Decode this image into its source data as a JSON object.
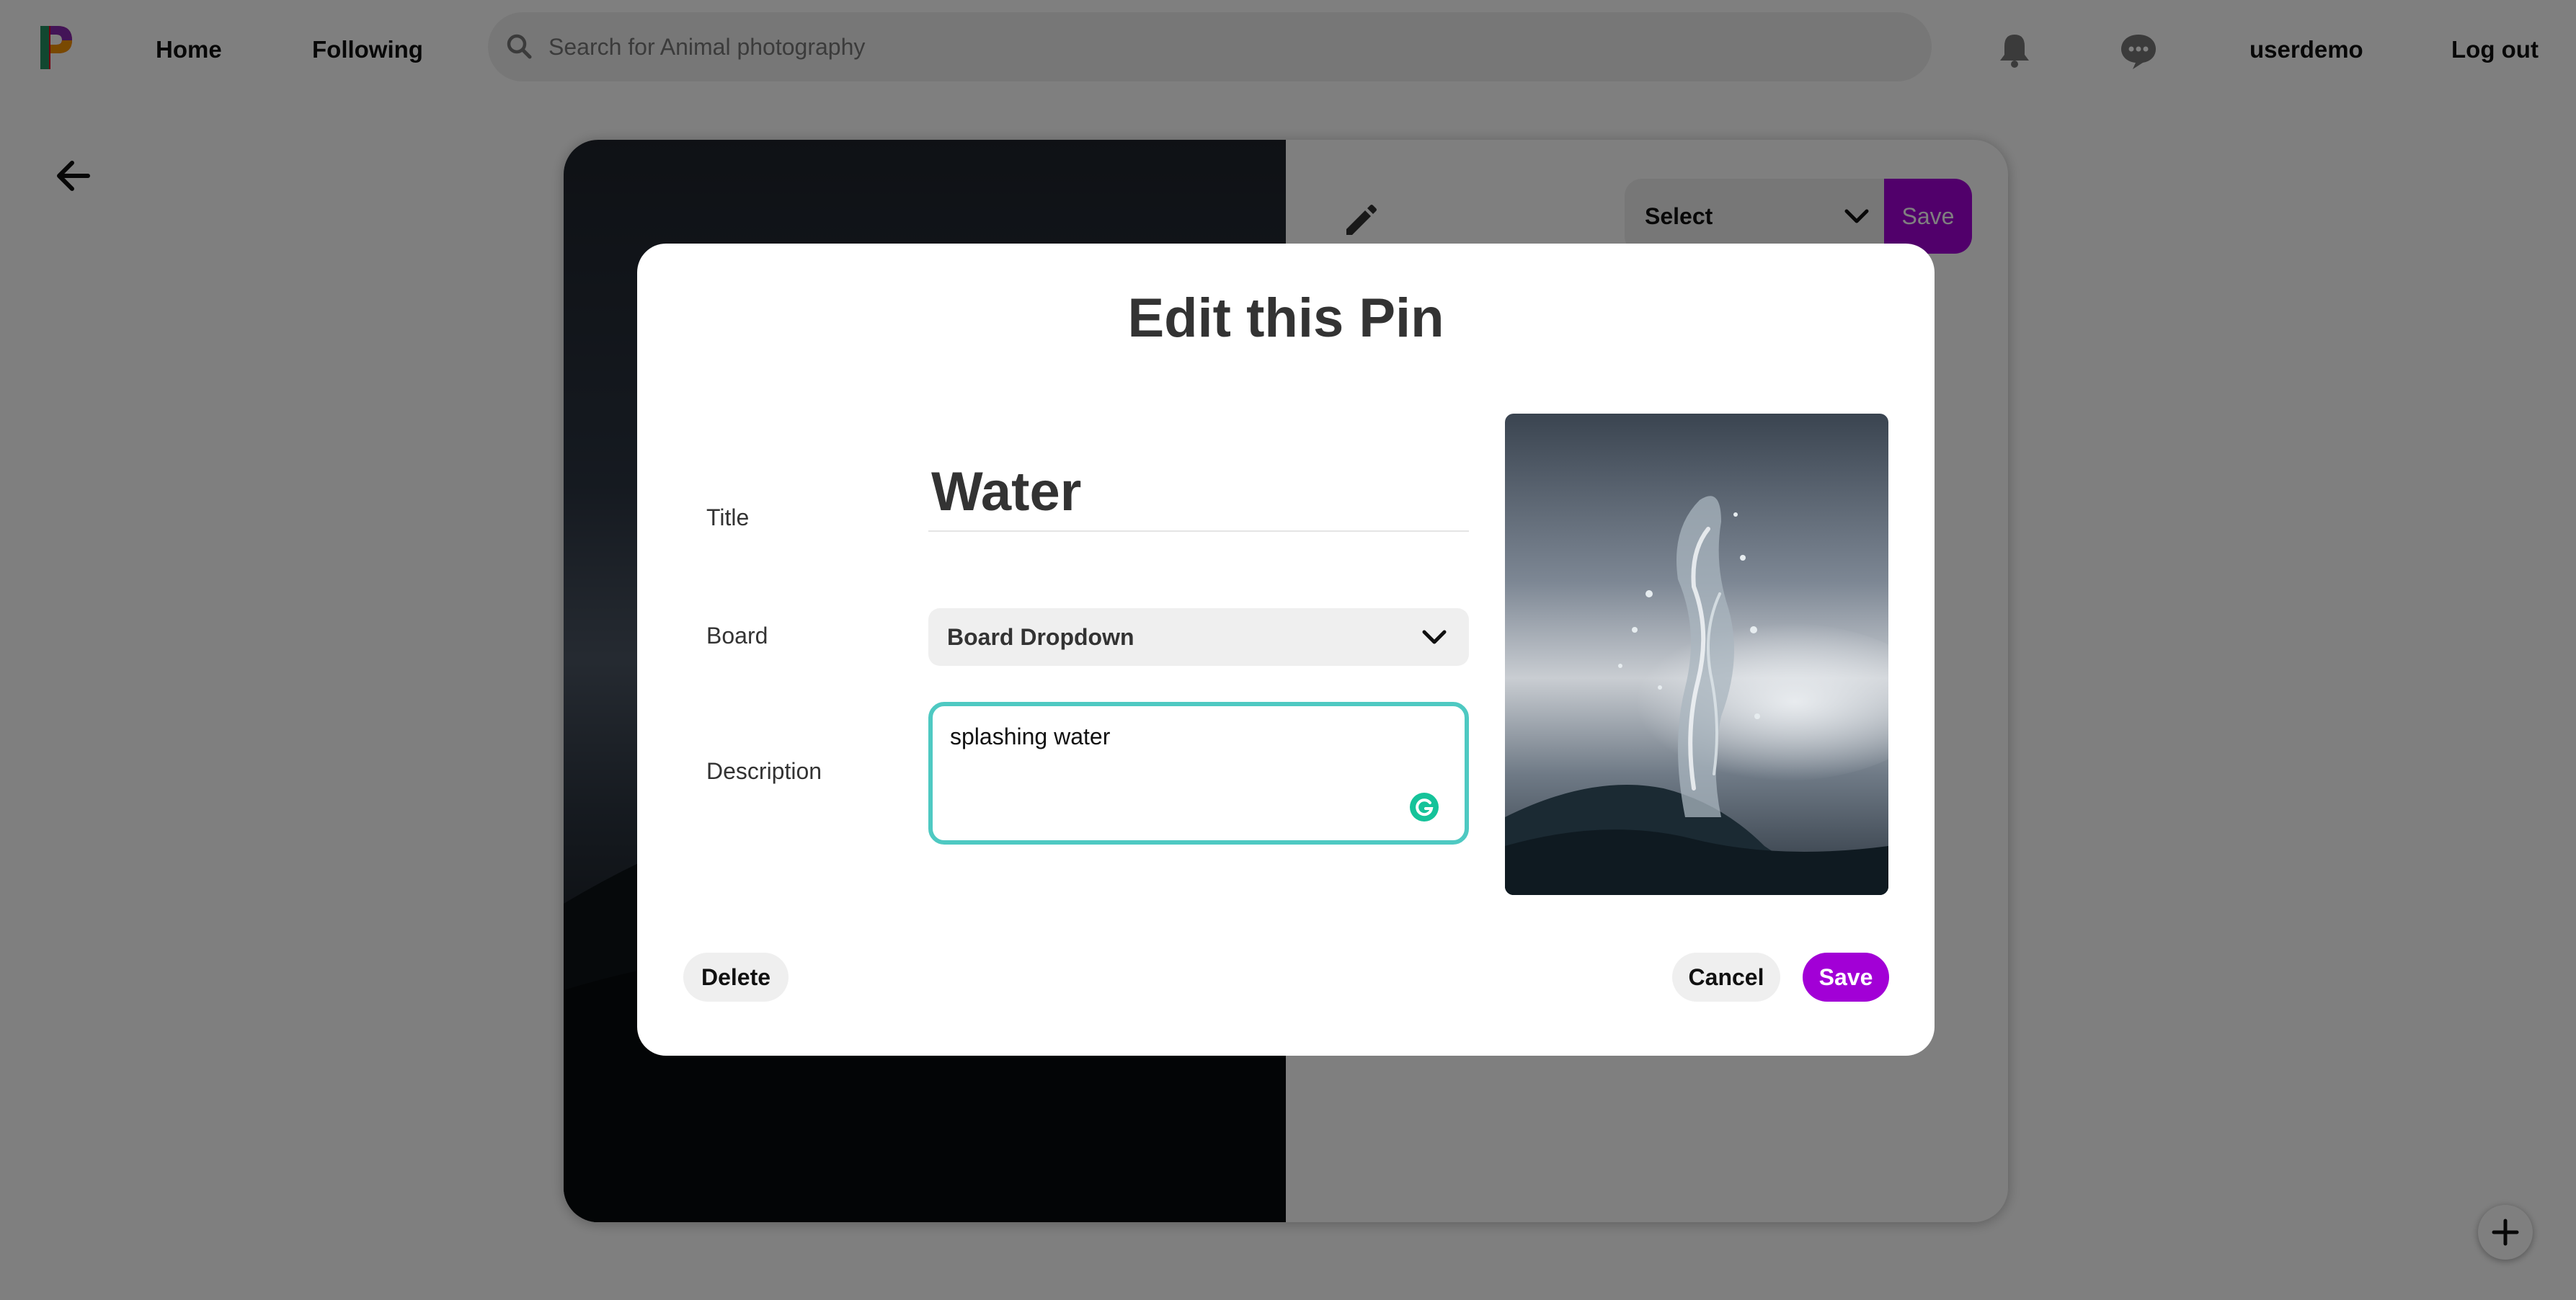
{
  "nav": {
    "logo_icon": "pinterest-style-p-logo-icon",
    "home_label": "Home",
    "following_label": "Following",
    "search_placeholder": "Search for Animal photography",
    "search_icon": "search-icon",
    "notifications_icon": "bell-icon",
    "messages_icon": "chat-bubble-icon",
    "user_label": "userdemo",
    "logout_label": "Log out"
  },
  "page": {
    "back_icon": "arrow-left-icon"
  },
  "pin_card": {
    "edit_icon": "pencil-icon",
    "board_select_label": "Select",
    "save_label": "Save"
  },
  "modal": {
    "title": "Edit this Pin",
    "fields": {
      "title_label": "Title",
      "title_value": "Water",
      "board_label": "Board",
      "board_value": "Board Dropdown",
      "description_label": "Description",
      "description_value": "splashing water"
    },
    "grammarly_icon": "grammarly-icon",
    "buttons": {
      "delete": "Delete",
      "cancel": "Cancel",
      "save": "Save"
    }
  },
  "colors": {
    "accent": "#a200d6",
    "focus_border": "#4ec9c2",
    "overlay": "rgba(0,0,0,0.5)"
  },
  "fab": {
    "add_icon": "plus-icon"
  }
}
